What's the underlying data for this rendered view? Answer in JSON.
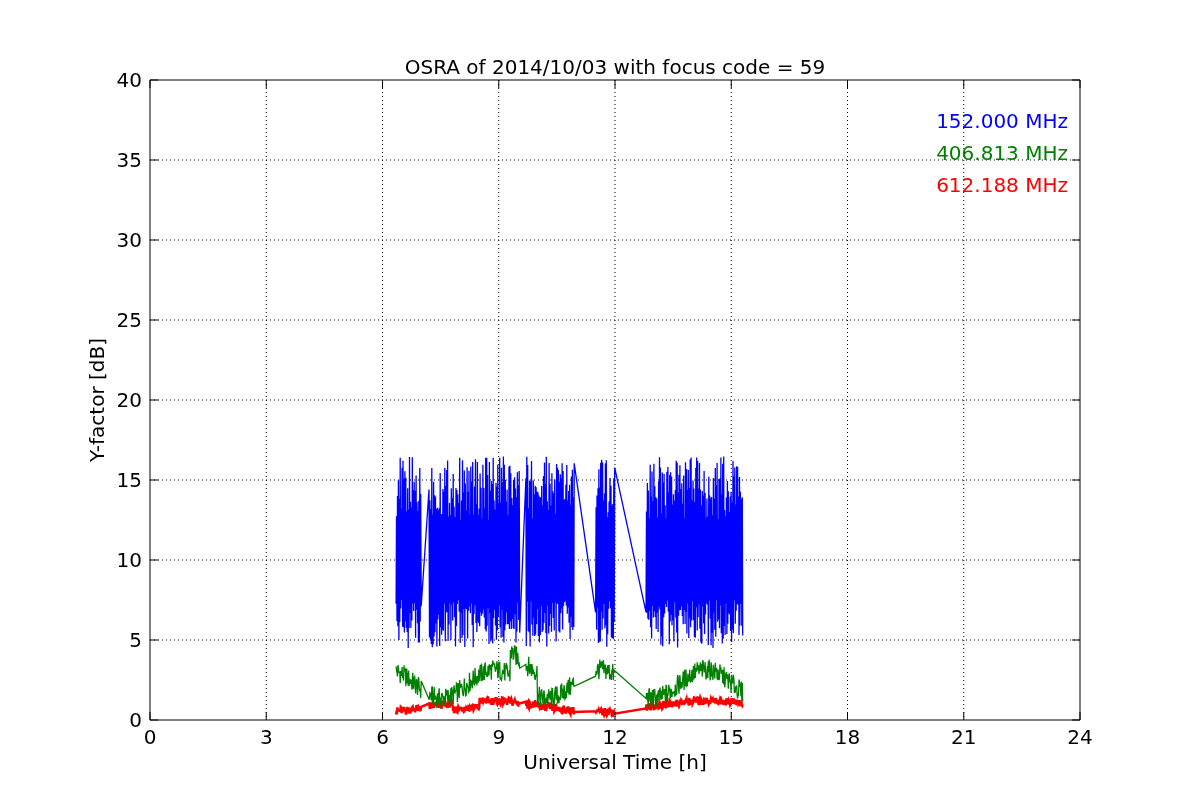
{
  "chart": {
    "title": "OSRA of 2014/10/03 with focus code = 59",
    "xlabel": "Universal Time [h]",
    "ylabel": "Y-factor [dB]",
    "xticks": [
      "0",
      "3",
      "6",
      "9",
      "12",
      "15",
      "18",
      "21",
      "24"
    ],
    "yticks": [
      "40",
      "35",
      "30",
      "25",
      "20",
      "15",
      "10",
      "5",
      "0"
    ],
    "legend": [
      {
        "label": "152.000 MHz",
        "color": "#0000ff"
      },
      {
        "label": "406.813 MHz",
        "color": "#008000"
      },
      {
        "label": "612.188 MHz",
        "color": "#ff0000"
      }
    ]
  }
}
